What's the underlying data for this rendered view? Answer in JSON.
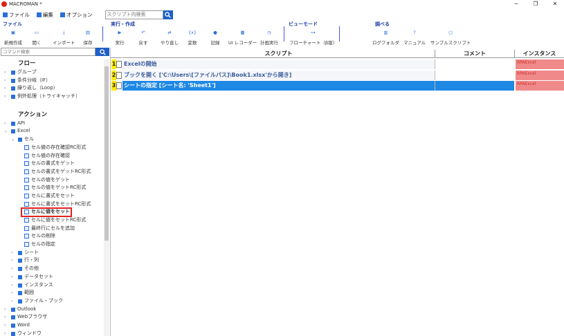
{
  "window": {
    "title": "MACROMAN *",
    "minimize": "─",
    "maximize": "❐",
    "close": "✕"
  },
  "menu": {
    "file": "ファイル",
    "edit": "編集",
    "options": "オプション",
    "search_placeholder": "スクリプト内検索"
  },
  "ribbon": {
    "groups": {
      "file": "ファイル",
      "run": "実行・作成",
      "view": "ビューモード",
      "research": "調べる"
    },
    "buttons": {
      "new": "新規作成",
      "open": "開く",
      "import": "インポート",
      "save": "保存",
      "run": "実行",
      "undo": "戻す",
      "redo": "やり直し",
      "variable": "変数",
      "record": "記録",
      "ui_recorder": "UI レコーダー",
      "scheduled": "計画実行",
      "flowchart": "フローチャート（β版）",
      "log_folder": "ログフォルダ",
      "manual": "マニュアル",
      "sample": "サンプルスクリプト"
    }
  },
  "left": {
    "search_placeholder": "コマンド検索",
    "flow_header": "フロー",
    "flow_items": [
      "グループ",
      "条件分岐（IF）",
      "繰り返し（Loop）",
      "例外処理（トライキャッチ）"
    ],
    "action_header": "アクション",
    "api": "API",
    "excel": "Excel",
    "cell": "セル",
    "cell_items": [
      "セル値の存在確認RC形式",
      "セル値の存在確認",
      "セルの書式をゲット",
      "セルの書式をゲットRC形式",
      "セルの値をゲット",
      "セルの値をゲットRC形式",
      "セルに書式をセット",
      "セルに書式をセットRC形式",
      "セルに値をセット",
      "セルに値をセットRC形式",
      "最終行にセルを追加",
      "セルの削除",
      "セルの指定"
    ],
    "excel_more": [
      "シート",
      "行・列",
      "その他",
      "データセット",
      "インスタンス",
      "範囲",
      "ファイル・ブック"
    ],
    "top_more": [
      "Outlook",
      "Webブラウザ",
      "Word",
      "ウィンドウ"
    ]
  },
  "grid": {
    "headers": {
      "script": "スクリプト",
      "comment": "コメント",
      "instance": "インスタンス"
    },
    "rows": [
      {
        "num": "1",
        "text": "Excelの開始",
        "instance": "RPAExcel"
      },
      {
        "num": "2",
        "text": "ブックを開く ['C:\\Users\\[ファイルパス]\\Book1.xlsx'から開き]",
        "instance": "RPAExcel"
      },
      {
        "num": "3",
        "text": "シートの指定 [シート名: 'Sheet1']",
        "instance": "RPAExcel"
      }
    ]
  },
  "colors": {
    "accent": "#1f5fc7",
    "selected_row": "#1e88e5",
    "row_number": "#ffea00",
    "instance_bg": "#f08a8a",
    "highlight": "#e02020"
  },
  "icons": {
    "run": "play-icon",
    "search": "search-icon",
    "folder": "folder-icon"
  }
}
